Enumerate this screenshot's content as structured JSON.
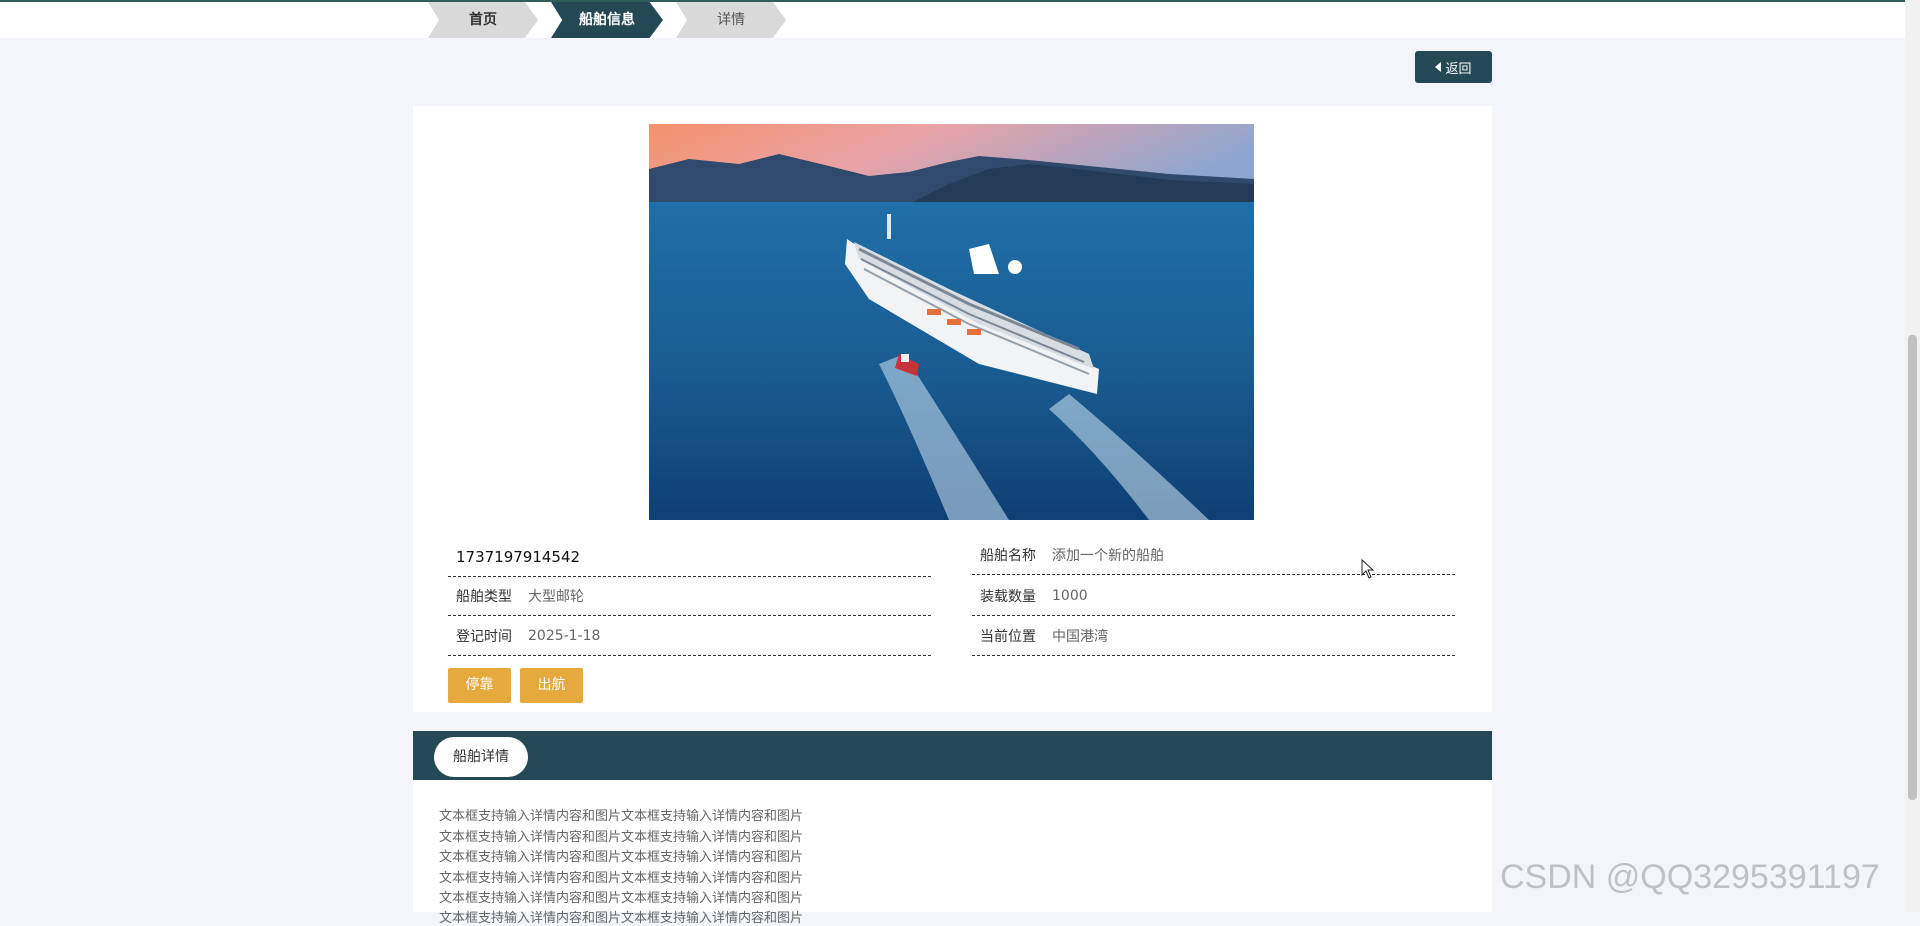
{
  "breadcrumb": [
    {
      "label": "首页"
    },
    {
      "label": "船舶信息"
    },
    {
      "label": "详情"
    }
  ],
  "back_button": {
    "label": "返回"
  },
  "ship": {
    "id": "1737197914542",
    "name_label": "船舶名称",
    "name": "添加一个新的船舶",
    "type_label": "船舶类型",
    "type": "大型邮轮",
    "qty_label": "装载数量",
    "qty": "1000",
    "date_label": "登记时间",
    "date": "2025-1-18",
    "location_label": "当前位置",
    "location": "中国港湾"
  },
  "actions": {
    "dock": "停靠",
    "sail": "出航"
  },
  "detail": {
    "tab_label": "船舶详情",
    "lines": [
      "文本框支持输入详情内容和图片文本框支持输入详情内容和图片",
      "文本框支持输入详情内容和图片文本框支持输入详情内容和图片",
      "文本框支持输入详情内容和图片文本框支持输入详情内容和图片",
      "文本框支持输入详情内容和图片文本框支持输入详情内容和图片",
      "文本框支持输入详情内容和图片文本框支持输入详情内容和图片",
      "文本框支持输入详情内容和图片文本框支持输入详情内容和图片"
    ]
  },
  "watermark": "CSDN @QQ3295391197",
  "colors": {
    "primary": "#244955",
    "accent": "#e6a93e",
    "background": "#f3f5fb"
  }
}
